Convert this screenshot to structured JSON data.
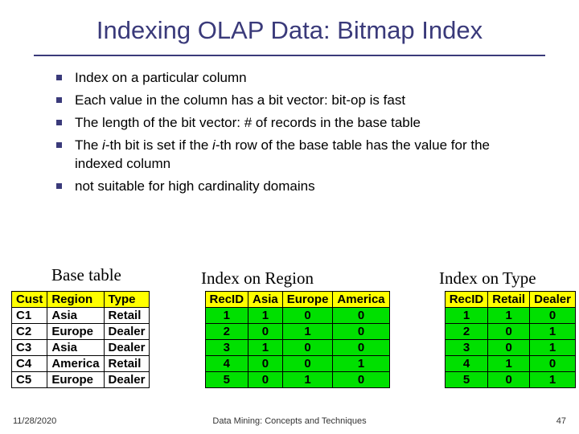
{
  "title": "Indexing OLAP Data: Bitmap Index",
  "bullets": {
    "b1": "Index on a particular column",
    "b2": "Each value in the column has a bit vector: bit-op is fast",
    "b3": "The length of the bit vector: # of records in the base table",
    "b4_a": "The ",
    "b4_i1": "i",
    "b4_b": "-th bit is set if the ",
    "b4_i2": "i",
    "b4_c": "-th row of the base table has the value for the indexed column",
    "b5": "not suitable for high cardinality domains"
  },
  "labels": {
    "base": "Base table",
    "region": "Index on Region",
    "type": "Index on Type"
  },
  "base_table": {
    "headers": {
      "h1": "Cust",
      "h2": "Region",
      "h3": "Type"
    },
    "rows": [
      {
        "c1": "C1",
        "c2": "Asia",
        "c3": "Retail"
      },
      {
        "c1": "C2",
        "c2": "Europe",
        "c3": "Dealer"
      },
      {
        "c1": "C3",
        "c2": "Asia",
        "c3": "Dealer"
      },
      {
        "c1": "C4",
        "c2": "America",
        "c3": "Retail"
      },
      {
        "c1": "C5",
        "c2": "Europe",
        "c3": "Dealer"
      }
    ]
  },
  "region_index": {
    "headers": {
      "h1": "RecID",
      "h2": "Asia",
      "h3": "Europe",
      "h4": "America"
    },
    "rows": [
      {
        "c1": "1",
        "c2": "1",
        "c3": "0",
        "c4": "0"
      },
      {
        "c1": "2",
        "c2": "0",
        "c3": "1",
        "c4": "0"
      },
      {
        "c1": "3",
        "c2": "1",
        "c3": "0",
        "c4": "0"
      },
      {
        "c1": "4",
        "c2": "0",
        "c3": "0",
        "c4": "1"
      },
      {
        "c1": "5",
        "c2": "0",
        "c3": "1",
        "c4": "0"
      }
    ]
  },
  "type_index": {
    "headers": {
      "h1": "RecID",
      "h2": "Retail",
      "h3": "Dealer"
    },
    "rows": [
      {
        "c1": "1",
        "c2": "1",
        "c3": "0"
      },
      {
        "c1": "2",
        "c2": "0",
        "c3": "1"
      },
      {
        "c1": "3",
        "c2": "0",
        "c3": "1"
      },
      {
        "c1": "4",
        "c2": "1",
        "c3": "0"
      },
      {
        "c1": "5",
        "c2": "0",
        "c3": "1"
      }
    ]
  },
  "footer": {
    "date": "11/28/2020",
    "mid": "Data Mining: Concepts and Techniques",
    "page": "47"
  }
}
